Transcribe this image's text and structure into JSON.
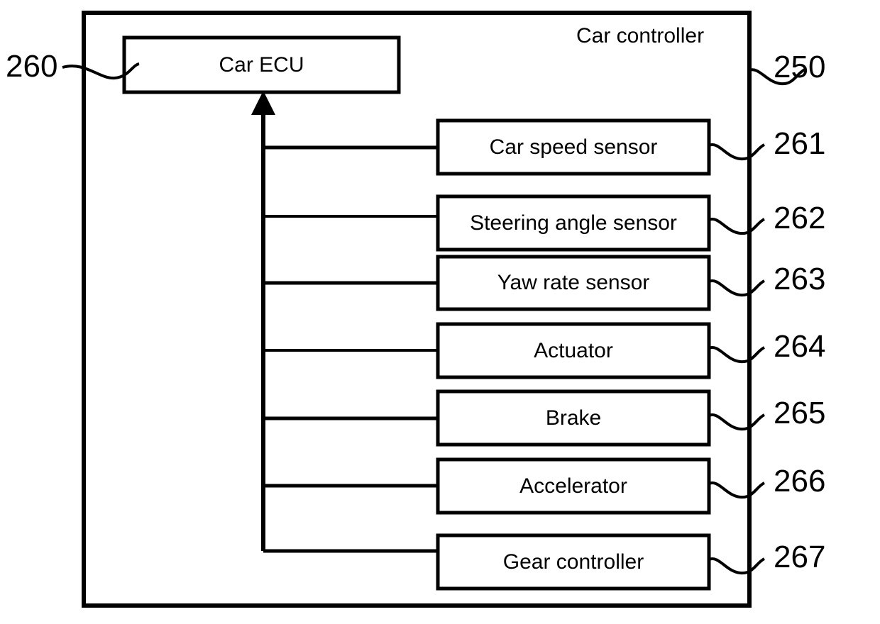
{
  "figure": {
    "kind": "patent-block-diagram",
    "background_color": "#ffffff",
    "line_color": "#000000",
    "outer_container": {
      "title": "Car controller",
      "reference_number": "250",
      "left_reference_number": "260"
    },
    "ecu": {
      "label": "Car ECU"
    },
    "modules": [
      {
        "label": "Car speed sensor",
        "reference_number": "261"
      },
      {
        "label": "Steering angle sensor",
        "reference_number": "262"
      },
      {
        "label": "Yaw rate sensor",
        "reference_number": "263"
      },
      {
        "label": "Actuator",
        "reference_number": "264"
      },
      {
        "label": "Brake",
        "reference_number": "265"
      },
      {
        "label": "Accelerator",
        "reference_number": "266"
      },
      {
        "label": "Gear controller",
        "reference_number": "267"
      }
    ]
  }
}
